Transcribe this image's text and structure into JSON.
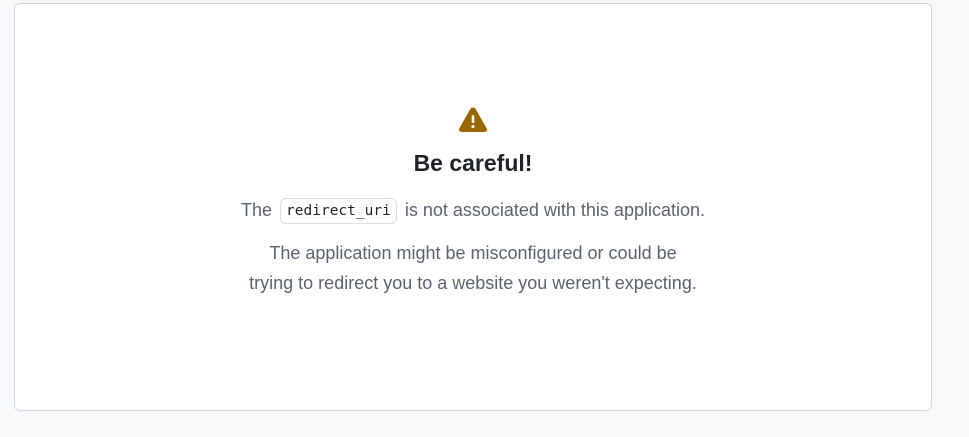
{
  "card": {
    "icon": "alert-triangle-icon",
    "icon_color": "#9a6700",
    "title": "Be careful!",
    "message_prefix": "The",
    "message_code": "redirect_uri",
    "message_suffix": "is not associated with this application.",
    "warning_line_1": "The application might be misconfigured or could be",
    "warning_line_2": "trying to redirect you to a website you weren't expecting."
  }
}
